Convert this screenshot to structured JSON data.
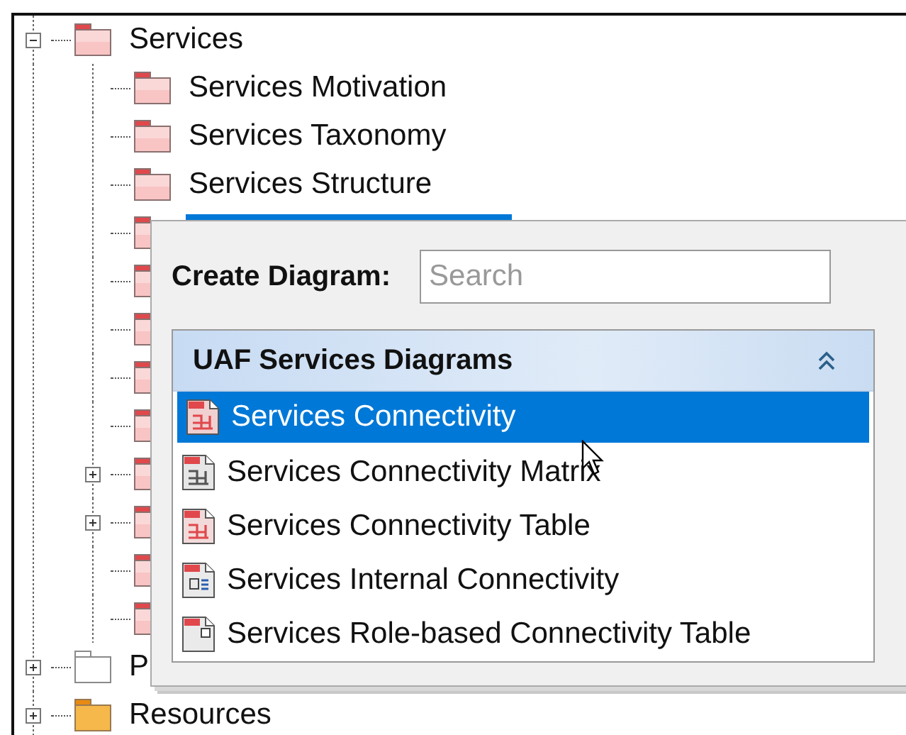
{
  "tree": {
    "items": [
      {
        "label": "Services",
        "kind": "package",
        "expanded": true,
        "selected": false,
        "children": [
          {
            "label": "Services Motivation",
            "kind": "package",
            "selected": false
          },
          {
            "label": "Services Taxonomy",
            "kind": "package",
            "selected": false
          },
          {
            "label": "Services Structure",
            "kind": "package",
            "selected": false
          },
          {
            "kind": "package",
            "selected": true
          },
          {
            "kind": "package"
          },
          {
            "kind": "package"
          },
          {
            "kind": "package"
          },
          {
            "kind": "package"
          },
          {
            "kind": "package",
            "expanded": false
          },
          {
            "kind": "package",
            "expanded": false
          },
          {
            "kind": "package"
          },
          {
            "kind": "package"
          }
        ]
      },
      {
        "label": "P",
        "kind": "folder",
        "expanded": false,
        "selected": false
      },
      {
        "label": "Resources",
        "kind": "library",
        "expanded": false,
        "selected": false
      }
    ]
  },
  "popup": {
    "label": "Create Diagram:",
    "search": {
      "placeholder": "Search"
    },
    "group": {
      "title": "UAF Services Diagrams",
      "expanded": true,
      "items": [
        {
          "label": "Services Connectivity",
          "kind": "diagram",
          "selected": true
        },
        {
          "label": "Services Connectivity Matrix",
          "kind": "matrix",
          "selected": false
        },
        {
          "label": "Services Connectivity Table",
          "kind": "table",
          "selected": false
        },
        {
          "label": "Services Internal Connectivity",
          "kind": "internal",
          "selected": false
        },
        {
          "label": "Services Role-based Connectivity Table",
          "kind": "role-table",
          "selected": false
        }
      ]
    }
  }
}
